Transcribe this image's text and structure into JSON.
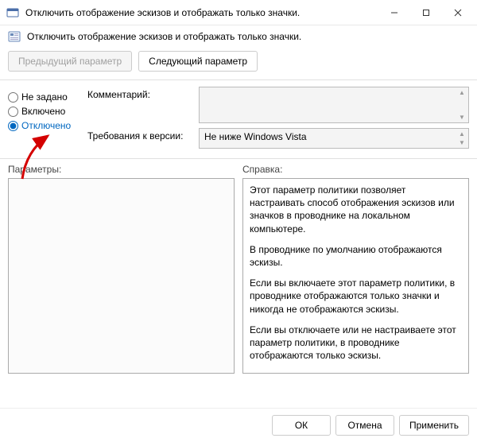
{
  "window": {
    "title": "Отключить отображение эскизов и отображать только значки."
  },
  "subtitle": "Отключить отображение эскизов и отображать только значки.",
  "nav": {
    "prev": "Предыдущий параметр",
    "next": "Следующий параметр"
  },
  "radios": {
    "not_configured": "Не задано",
    "enabled": "Включено",
    "disabled": "Отключено"
  },
  "fields": {
    "comment_label": "Комментарий:",
    "comment_value": "",
    "requirements_label": "Требования к версии:",
    "requirements_value": "Не ниже Windows Vista"
  },
  "columns": {
    "options_label": "Параметры:",
    "help_label": "Справка:"
  },
  "help": {
    "p1": "Этот параметр политики позволяет настраивать способ отображения эскизов или значков в проводнике на локальном компьютере.",
    "p2": "В проводнике по умолчанию отображаются эскизы.",
    "p3": "Если вы включаете этот параметр политики, в проводнике отображаются только значки и никогда не отображаются эскизы.",
    "p4": "Если вы отключаете или не настраиваете этот параметр политики, в проводнике отображаются только эскизы."
  },
  "footer": {
    "ok": "ОК",
    "cancel": "Отмена",
    "apply": "Применить"
  }
}
